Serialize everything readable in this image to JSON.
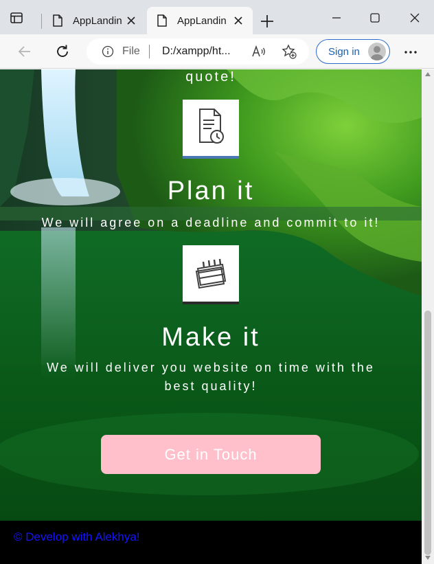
{
  "browser": {
    "tabs": [
      {
        "label": "AppLandin",
        "active": false
      },
      {
        "label": "AppLandin",
        "active": true
      }
    ],
    "address": {
      "scheme_label": "File",
      "url": "D:/xampp/ht..."
    },
    "signin_label": "Sign in",
    "icons": [
      "sidebar-toggle-icon",
      "page-icon",
      "close-icon",
      "new-tab-icon",
      "minimize-icon",
      "maximize-icon",
      "window-close-icon",
      "back-icon",
      "refresh-icon",
      "info-icon",
      "read-aloud-icon",
      "add-favorite-icon",
      "avatar",
      "more-icon"
    ]
  },
  "page": {
    "quote_tail": "quote!",
    "features": [
      {
        "title": "Plan it",
        "description": "We will agree on a deadline and commit to it!",
        "icon": "document-clock-icon"
      },
      {
        "title": "Make it",
        "description": "We will deliver you website on time with the best quality!",
        "icon": "calendar-icon"
      }
    ],
    "cta_label": "Get in Touch",
    "footer_text": "© Develop with Alekhya!"
  },
  "colors": {
    "cta_background": "#ffc0cb",
    "footer_background": "#000000",
    "footer_text": "#1414ff",
    "signin_accent": "#1a5fb4"
  }
}
